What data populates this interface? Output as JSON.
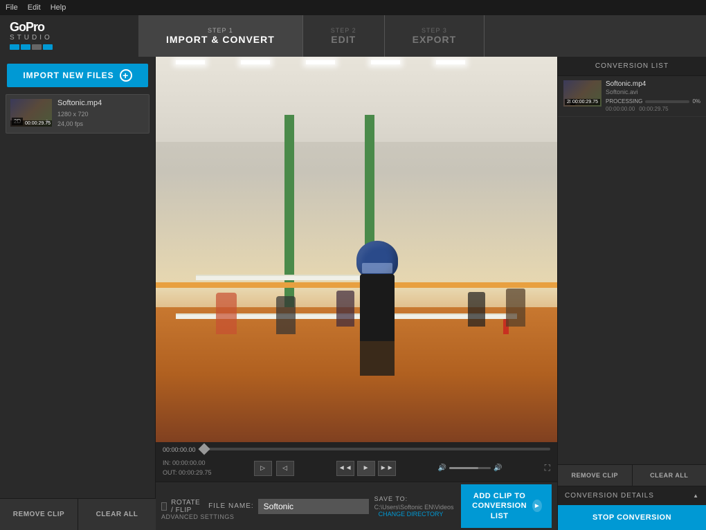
{
  "titlebar": {
    "menus": [
      "File",
      "Edit",
      "Help"
    ]
  },
  "logo": {
    "brand": "GoPro",
    "product": "STUDIO",
    "dots": [
      {
        "color": "#0099d4"
      },
      {
        "color": "#0099d4"
      },
      {
        "color": "#888"
      },
      {
        "color": "#0099d4"
      }
    ]
  },
  "steps": [
    {
      "num": "STEP 1",
      "label": "IMPORT & CONVERT",
      "active": true
    },
    {
      "num": "STEP 2",
      "label": "EDIT",
      "active": false
    },
    {
      "num": "STEP 3",
      "label": "EXPORT",
      "active": false
    }
  ],
  "sidebar": {
    "import_btn": "IMPORT NEW FILES",
    "files": [
      {
        "name": "Softonic.mp4",
        "badge": "2D",
        "duration": "00:00:29.75",
        "resolution": "1280 x 720",
        "fps": "24,00 fps"
      }
    ]
  },
  "video": {
    "time_display": "00:00:00.00",
    "in_point": "IN: 00:00:00.00",
    "out_point": "OUT: 00:00:29.75"
  },
  "bottom_bar": {
    "rotate_flip": "ROTATE / FLIP",
    "file_name_label": "FILE NAME:",
    "file_name_value": "Softonic",
    "save_to_label": "SAVE TO:",
    "save_to_path": "C:\\Users\\Softonic EN\\Videos",
    "change_dir": "CHANGE DIRECTORY",
    "add_clip_label": "ADD CLIP TO\nCONVERSION LIST",
    "advanced_settings": "ADVANCED SETTINGS"
  },
  "footer": {
    "remove_clip": "REMOVE CLIP",
    "clear_all": "CLEAR ALL"
  },
  "right_panel": {
    "conversion_list_header": "CONVERSION LIST",
    "items": [
      {
        "name": "Softonic.mp4",
        "output": "Softonic.avi",
        "badge": "2D",
        "duration": "00:00:29.75",
        "progress_label": "PROCESSING",
        "progress_pct": "0%",
        "time_elapsed": "00:00:00.00",
        "time_total": "00:00:29.75"
      }
    ],
    "remove_clip": "REMOVE CLIP",
    "clear_all": "CLEAR ALL",
    "conversion_details": "CONVERSION DETAILS",
    "stop_conversion": "STOP CONVERSION"
  }
}
